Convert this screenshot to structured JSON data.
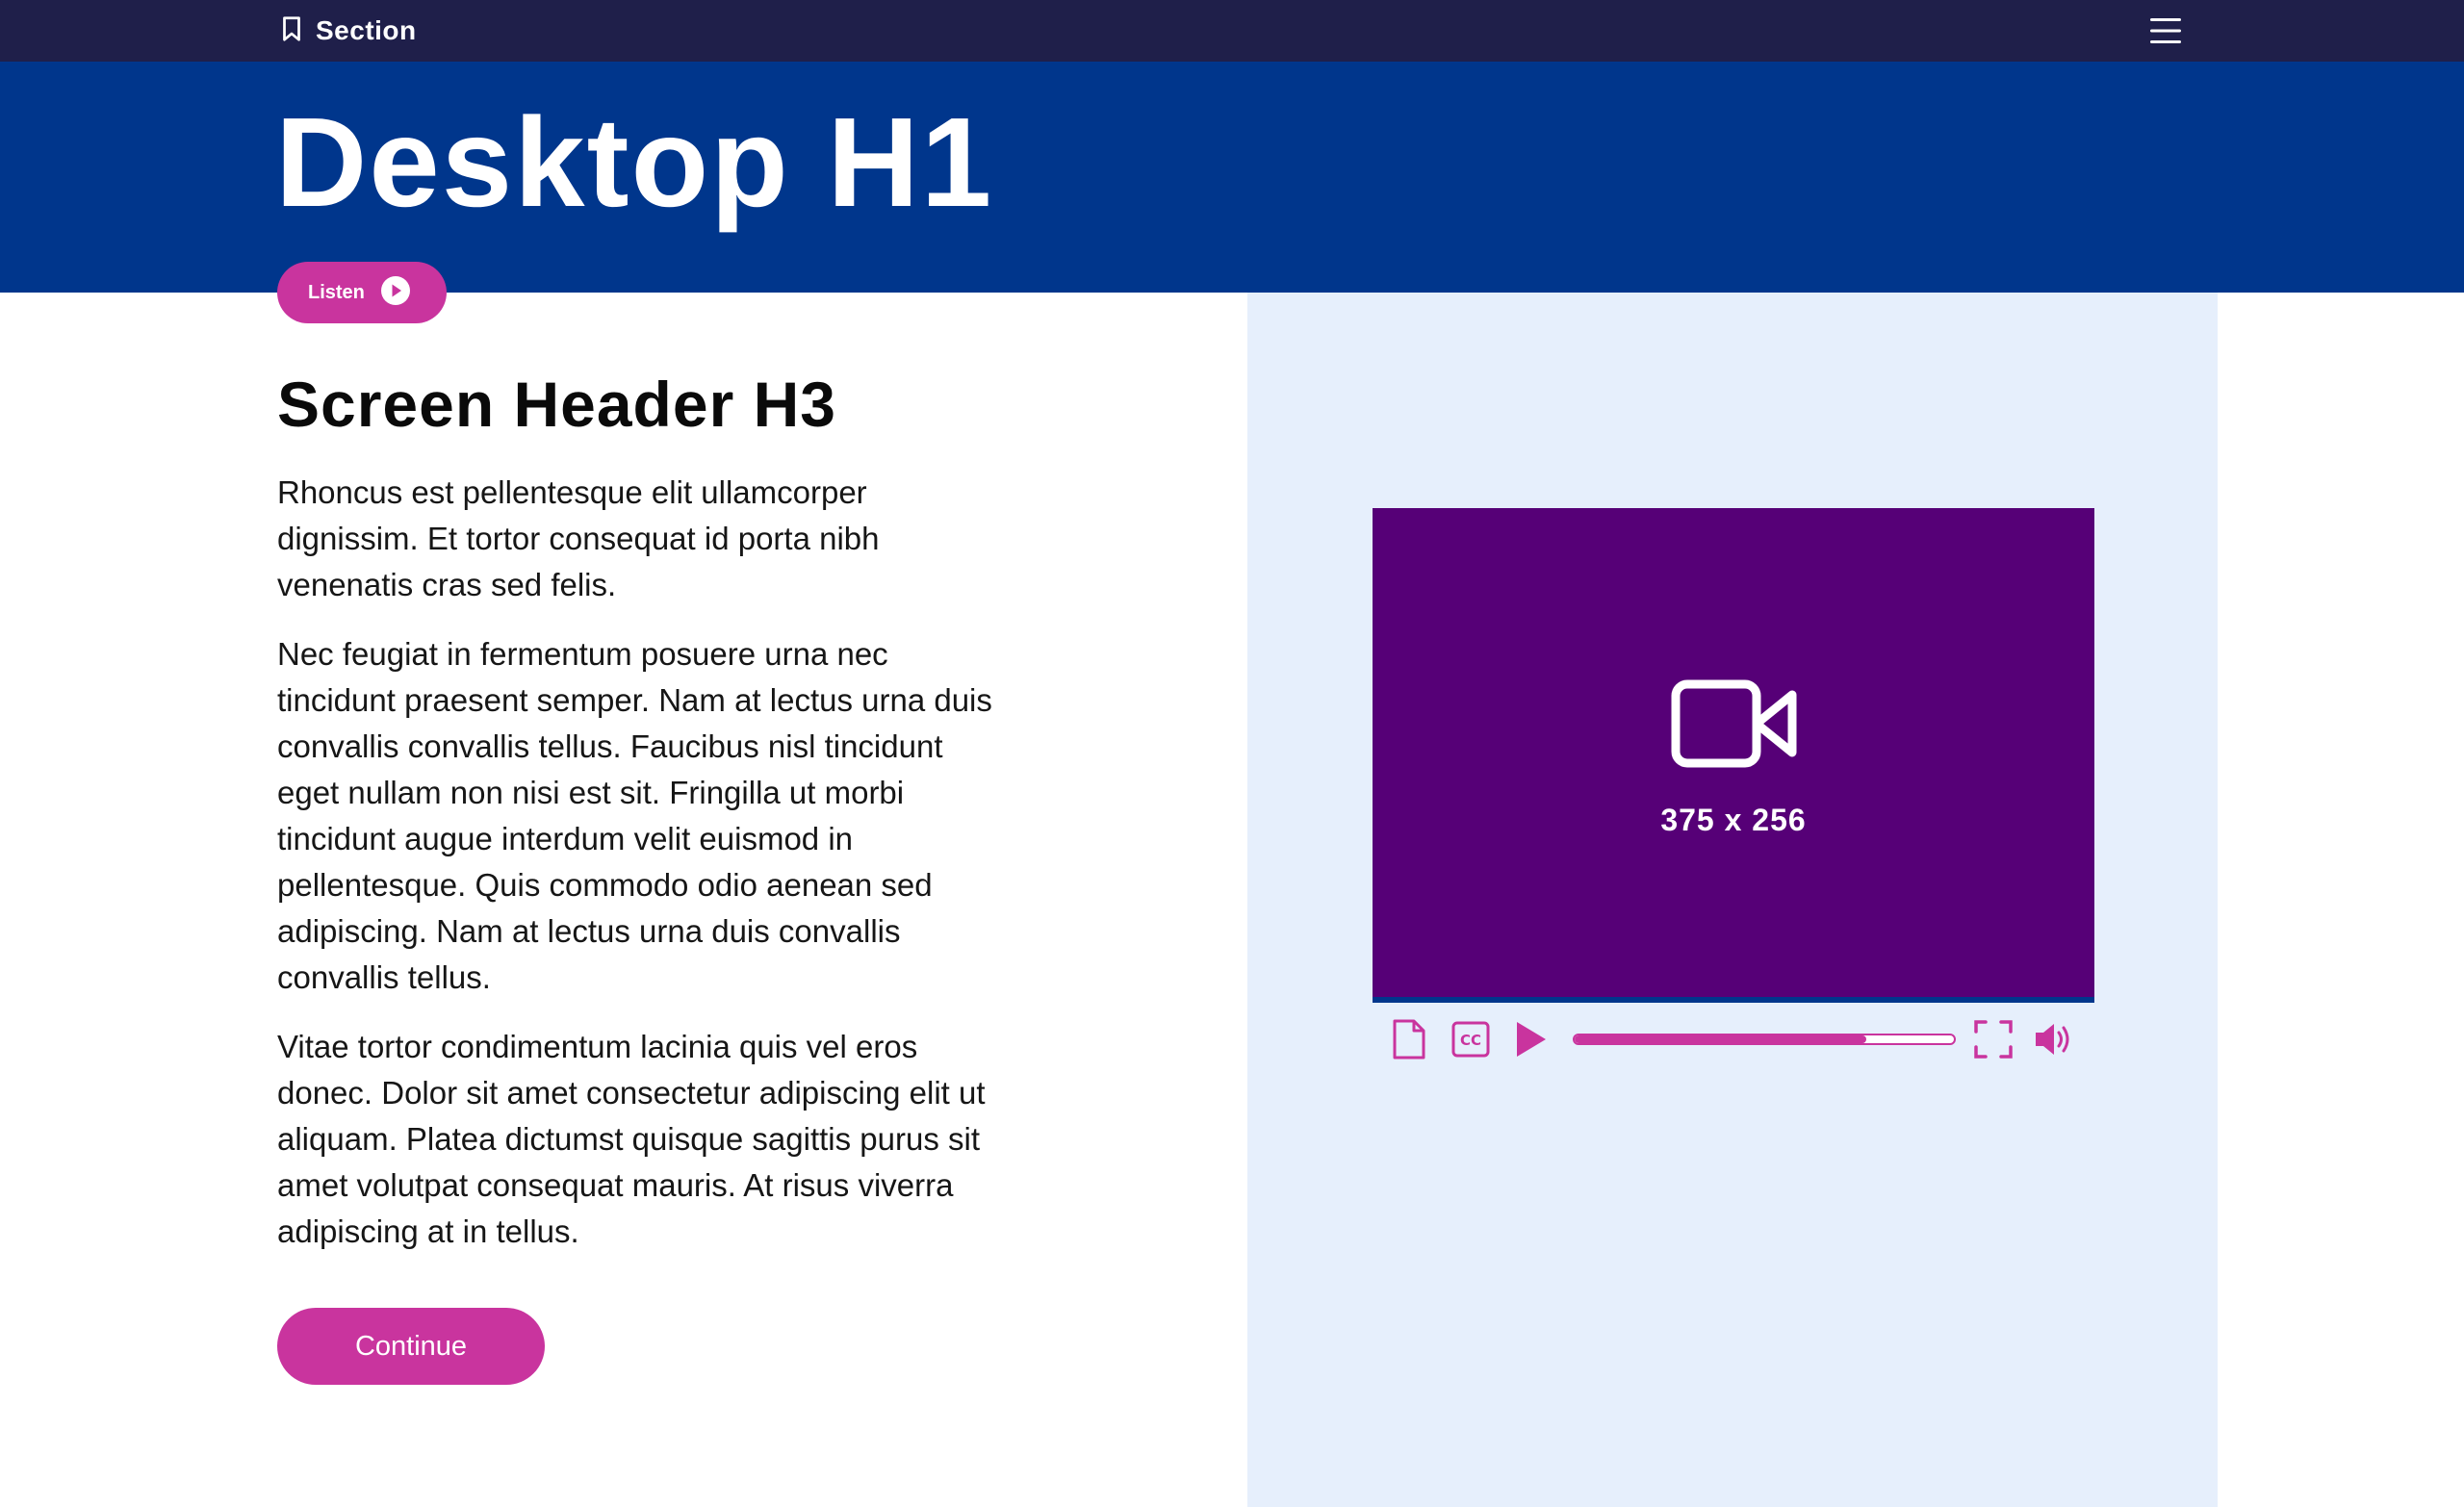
{
  "nav": {
    "section_label": "Section",
    "section_icon": "bookmark-icon",
    "menu_icon": "hamburger-menu-icon"
  },
  "header": {
    "title": "Desktop H1",
    "listen_label": "Listen",
    "listen_icon": "play-circle-icon"
  },
  "content": {
    "heading": "Screen Header H3",
    "paragraphs": [
      "Rhoncus est pellentesque elit ullamcorper dignissim. Et tortor consequat id porta nibh venenatis cras sed felis.",
      "Nec feugiat in fermentum posuere urna nec tincidunt praesent semper. Nam at lectus urna duis convallis convallis tellus. Faucibus nisl tincidunt eget nullam non nisi est sit. Fringilla ut morbi tincidunt augue interdum velit euismod in pellentesque. Quis commodo odio aenean sed adipiscing. Nam at lectus urna duis convallis convallis tellus.",
      "Vitae tortor condimentum lacinia quis vel eros donec. Dolor sit amet consectetur adipiscing elit ut aliquam. Platea dictumst quisque sagittis purus sit amet volutpat consequat mauris. At risus viverra adipiscing at in tellus."
    ],
    "continue_label": "Continue"
  },
  "video": {
    "placeholder_label": "375 x 256",
    "placeholder_icon": "video-camera-icon",
    "controls": {
      "transcript_icon": "document-icon",
      "captions_icon": "closed-captions-icon",
      "play_icon": "play-icon",
      "fullscreen_icon": "fullscreen-icon",
      "volume_icon": "volume-icon",
      "progress_fraction": 0.77
    }
  },
  "colors": {
    "top_bar": "#1f1f4a",
    "hero": "#00368c",
    "accent": "#c9349e",
    "video_background": "#560077",
    "panel_background": "#e6effc"
  }
}
